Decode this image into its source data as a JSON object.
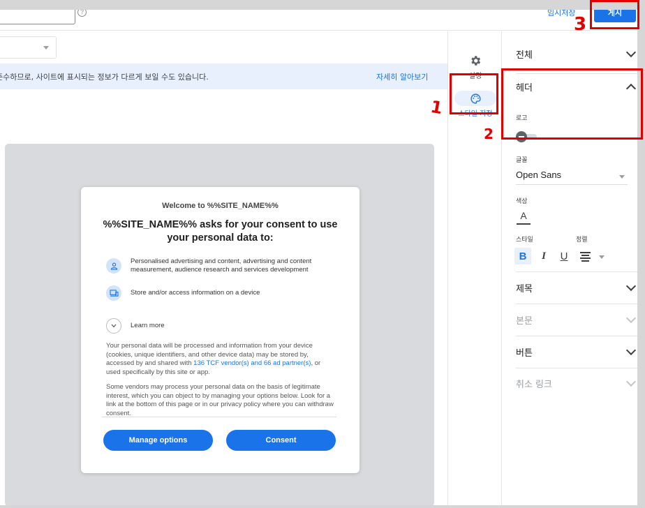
{
  "topbar": {
    "help_icon": "?",
    "draft_label": "임시저장",
    "publish_label": "게시"
  },
  "editor": {
    "banner_text": "준수하므로, 사이트에 표시되는 정보가 다르게 보일 수도 있습니다.",
    "banner_link": "자세히 알아보기"
  },
  "dialog": {
    "welcome": "Welcome to %%SITE_NAME%%",
    "title": "%%SITE_NAME%% asks for your consent to use your personal data to:",
    "purposes": [
      {
        "icon": "person-icon",
        "text": "Personalised advertising and content, advertising and content measurement, audience research and services development"
      },
      {
        "icon": "device-icon",
        "text": "Store and/or access information on a device"
      }
    ],
    "learn_more": "Learn more",
    "para1_before": "Your personal data will be processed and information from your device (cookies, unique identifiers, and other device data) may be stored by, accessed by and shared with ",
    "para1_link": "136 TCF vendor(s) and 66 ad partner(s)",
    "para1_after": ", or used specifically by this site or app.",
    "para2": "Some vendors may process your personal data on the basis of legitimate interest, which you can object to by managing your options below. Look for a link at the bottom of this page or in our privacy policy where you can withdraw consent.",
    "manage_label": "Manage options",
    "consent_label": "Consent"
  },
  "rail": {
    "settings_label": "설정",
    "settings_icon": "gear-icon",
    "style_label": "스타일 지정",
    "style_icon": "palette-icon"
  },
  "panel": {
    "overall": "전체",
    "header": "헤더",
    "logo_label": "로고",
    "logo_enabled": false,
    "font_label": "글꼴",
    "font_value": "Open Sans",
    "color_label": "색상",
    "color_glyph": "A",
    "style_label": "스타일",
    "align_label": "정렬",
    "bold": "B",
    "italic": "I",
    "underline": "U",
    "title": "제목",
    "body": "본문",
    "button": "버튼",
    "cancel_link": "취소 링크"
  },
  "annotations": {
    "mark1": "1",
    "mark2": "2",
    "mark3": "3",
    "color": "#e00000"
  }
}
